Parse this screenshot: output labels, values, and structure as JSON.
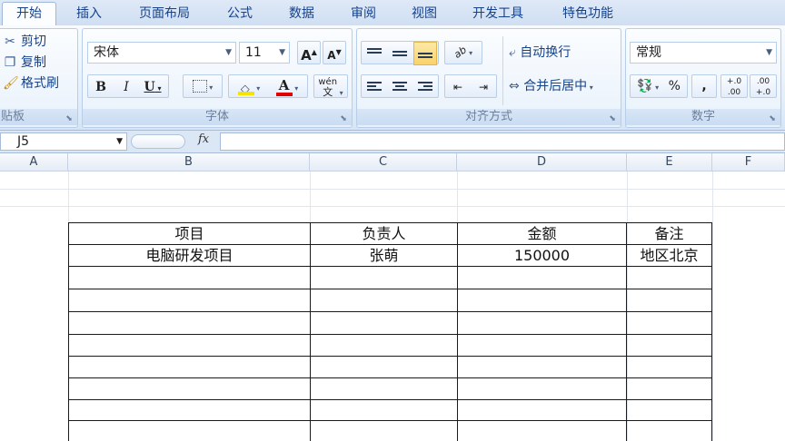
{
  "menu": {
    "tabs": [
      "开始",
      "插入",
      "页面布局",
      "公式",
      "数据",
      "审阅",
      "视图",
      "开发工具",
      "特色功能"
    ],
    "active": "开始"
  },
  "clipboard": {
    "cut": "剪切",
    "copy": "复制",
    "format_painter": "格式刷",
    "group_label": "贴板"
  },
  "font": {
    "name": "宋体",
    "size": "11",
    "grow": "A",
    "shrink": "A",
    "bold": "B",
    "italic": "I",
    "underline": "U",
    "font_color_letter": "A",
    "phonetic": "wén",
    "phonetic_char": "文",
    "group_label": "字体",
    "fill_color": "#f5e400",
    "font_color": "#e00000"
  },
  "alignment": {
    "wrap_text": "自动换行",
    "merge_center": "合并后居中",
    "group_label": "对齐方式",
    "orientation": "ab"
  },
  "number": {
    "format": "常规",
    "percent": "%",
    "comma": ",",
    "inc_decimal": "+.0 .00",
    "dec_decimal": ".00 +.0",
    "group_label": "数字"
  },
  "formula_bar": {
    "name_box": "J5",
    "fx": "fx",
    "content": ""
  },
  "columns": [
    "A",
    "B",
    "C",
    "D",
    "E",
    "F"
  ],
  "table": {
    "headers": [
      "项目",
      "负责人",
      "金额",
      "备注"
    ],
    "rows": [
      [
        "电脑研发项目",
        "张萌",
        "150000",
        "地区北京"
      ]
    ]
  }
}
